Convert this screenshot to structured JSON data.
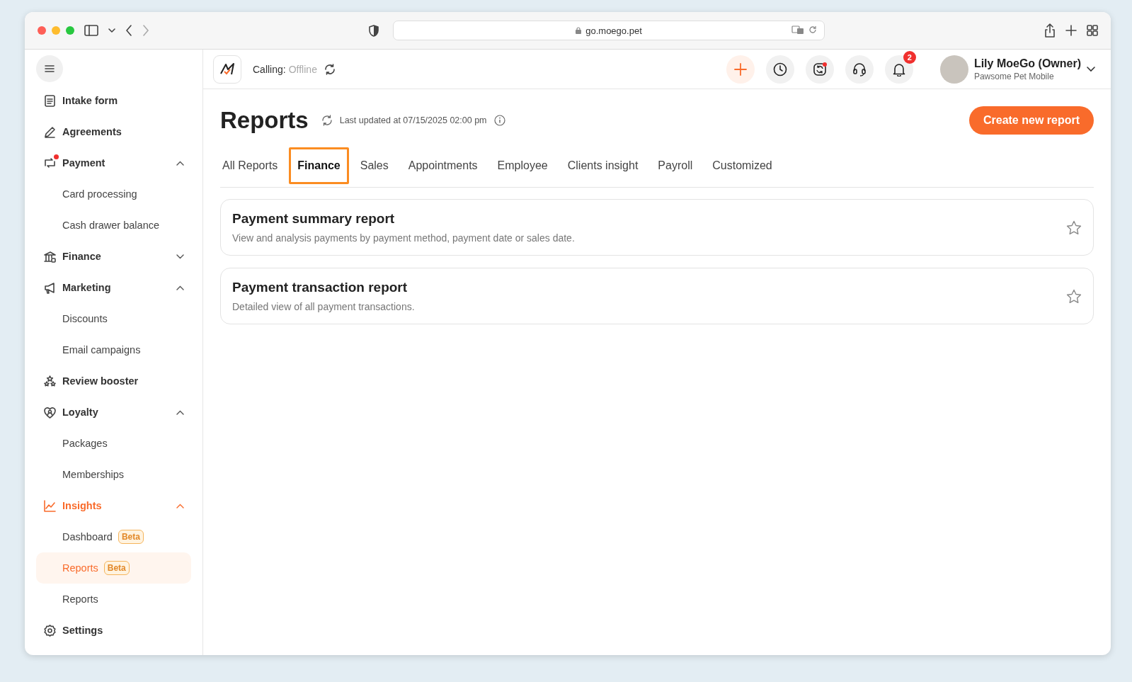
{
  "browser": {
    "url": "go.moego.pet"
  },
  "sidebar": {
    "items": [
      {
        "label": "Intake form",
        "selected": false
      },
      {
        "label": "Agreements",
        "selected": false
      },
      {
        "label": "Payment",
        "selected": false,
        "dot": true,
        "expanded": true,
        "children": [
          {
            "label": "Card processing",
            "selected": false
          },
          {
            "label": "Cash drawer balance",
            "selected": false
          }
        ]
      },
      {
        "label": "Finance",
        "selected": false,
        "expanded": false
      },
      {
        "label": "Marketing",
        "selected": false,
        "expanded": true,
        "children": [
          {
            "label": "Discounts",
            "selected": false
          },
          {
            "label": "Email campaigns",
            "selected": false
          }
        ]
      },
      {
        "label": "Review booster",
        "selected": false
      },
      {
        "label": "Loyalty",
        "selected": false,
        "expanded": true,
        "children": [
          {
            "label": "Packages",
            "selected": false
          },
          {
            "label": "Memberships",
            "selected": false
          }
        ]
      },
      {
        "label": "Insights",
        "selected": true,
        "expanded": true,
        "children": [
          {
            "label": "Dashboard",
            "badge": "Beta",
            "selected": false
          },
          {
            "label": "Reports",
            "badge": "Beta",
            "selected": true
          },
          {
            "label": "Reports",
            "selected": false
          }
        ]
      },
      {
        "label": "Settings",
        "selected": false
      }
    ]
  },
  "topbar": {
    "calling_label": "Calling:",
    "calling_status": "Offline",
    "notification_count": "2",
    "user_name": "Lily MoeGo (Owner)",
    "business": "Pawsome Pet Mobile"
  },
  "page": {
    "title": "Reports",
    "updated": "Last updated at 07/15/2025 02:00 pm",
    "create_button": "Create new report",
    "tabs": [
      {
        "label": "All Reports",
        "selected": false,
        "highlighted": false
      },
      {
        "label": "Finance",
        "selected": true,
        "highlighted": true
      },
      {
        "label": "Sales",
        "selected": false,
        "highlighted": false
      },
      {
        "label": "Appointments",
        "selected": false,
        "highlighted": false
      },
      {
        "label": "Employee",
        "selected": false,
        "highlighted": false
      },
      {
        "label": "Clients insight",
        "selected": false,
        "highlighted": false
      },
      {
        "label": "Payroll",
        "selected": false,
        "highlighted": false
      },
      {
        "label": "Customized",
        "selected": false,
        "highlighted": false
      }
    ],
    "reports": [
      {
        "title": "Payment summary report",
        "description": "View and analysis payments by payment method, payment date or sales date.",
        "starred": false
      },
      {
        "title": "Payment transaction report",
        "description": "Detailed view of all payment transactions.",
        "starred": false
      }
    ]
  }
}
